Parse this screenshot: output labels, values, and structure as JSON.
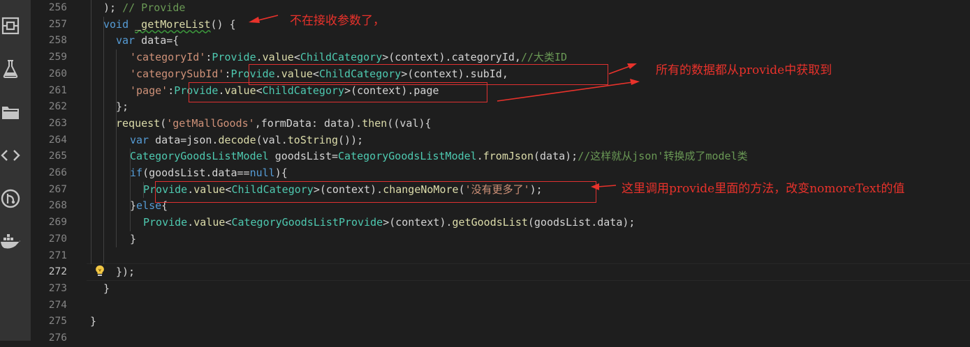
{
  "editor": {
    "current_line": "272",
    "line_numbers": [
      "256",
      "257",
      "258",
      "259",
      "260",
      "261",
      "262",
      "263",
      "264",
      "265",
      "266",
      "267",
      "268",
      "269",
      "270",
      "271",
      "272",
      "273",
      "274",
      "275",
      "276"
    ]
  },
  "activity_bar": [
    {
      "name": "explorer-icon"
    },
    {
      "name": "test-flask-icon"
    },
    {
      "name": "folder-icon"
    },
    {
      "name": "code-brackets-icon"
    },
    {
      "name": "git-icon"
    },
    {
      "name": "docker-icon"
    }
  ],
  "code_lines": [
    {
      "tokens": [
        [
          "pl",
          "); "
        ],
        [
          "cm",
          "// Provide"
        ]
      ]
    },
    {
      "tokens": [
        [
          "kw",
          "void"
        ],
        [
          "pl",
          " "
        ],
        [
          "fn",
          "_getMoreList"
        ],
        [
          "pl",
          "() {"
        ]
      ]
    },
    {
      "tokens": [
        [
          "kw",
          "var"
        ],
        [
          "pl",
          " data={"
        ]
      ]
    },
    {
      "tokens": [
        [
          "str",
          "'categoryId'"
        ],
        [
          "pl",
          ":"
        ],
        [
          "cls",
          "Provide"
        ],
        [
          "pl",
          "."
        ],
        [
          "fn",
          "value"
        ],
        [
          "pl",
          "<"
        ],
        [
          "cls",
          "ChildCategory"
        ],
        [
          "pl",
          ">(context).categoryId,"
        ],
        [
          "cm",
          "//大类ID"
        ]
      ]
    },
    {
      "tokens": [
        [
          "str",
          "'categorySubId'"
        ],
        [
          "pl",
          ":"
        ],
        [
          "cls",
          "Provide"
        ],
        [
          "pl",
          "."
        ],
        [
          "fn",
          "value"
        ],
        [
          "pl",
          "<"
        ],
        [
          "cls",
          "ChildCategory"
        ],
        [
          "pl",
          ">(context).subId,"
        ]
      ]
    },
    {
      "tokens": [
        [
          "str",
          "'page'"
        ],
        [
          "pl",
          ":"
        ],
        [
          "cls",
          "Provide"
        ],
        [
          "pl",
          "."
        ],
        [
          "fn",
          "value"
        ],
        [
          "pl",
          "<"
        ],
        [
          "cls",
          "ChildCategory"
        ],
        [
          "pl",
          ">(context).page"
        ]
      ]
    },
    {
      "tokens": [
        [
          "pl",
          "};"
        ]
      ]
    },
    {
      "tokens": [
        [
          "fn",
          "request"
        ],
        [
          "pl",
          "("
        ],
        [
          "str",
          "'getMallGoods'"
        ],
        [
          "pl",
          ",formData: data)."
        ],
        [
          "fn",
          "then"
        ],
        [
          "pl",
          "((val){"
        ]
      ]
    },
    {
      "tokens": [
        [
          "kw",
          "var"
        ],
        [
          "pl",
          " data=json."
        ],
        [
          "fn",
          "decode"
        ],
        [
          "pl",
          "(val."
        ],
        [
          "fn",
          "toString"
        ],
        [
          "pl",
          "());"
        ]
      ]
    },
    {
      "tokens": [
        [
          "cls",
          "CategoryGoodsListModel"
        ],
        [
          "pl",
          " goodsList="
        ],
        [
          "cls",
          "CategoryGoodsListModel"
        ],
        [
          "pl",
          "."
        ],
        [
          "fn",
          "fromJson"
        ],
        [
          "pl",
          "(data);"
        ],
        [
          "cm",
          "//这样就从json'转换成了model类"
        ]
      ]
    },
    {
      "tokens": [
        [
          "kw",
          "if"
        ],
        [
          "pl",
          "(goodsList.data=="
        ],
        [
          "kw",
          "null"
        ],
        [
          "pl",
          "){"
        ]
      ]
    },
    {
      "tokens": [
        [
          "cls",
          "Provide"
        ],
        [
          "pl",
          "."
        ],
        [
          "fn",
          "value"
        ],
        [
          "pl",
          "<"
        ],
        [
          "cls",
          "ChildCategory"
        ],
        [
          "pl",
          ">(context)."
        ],
        [
          "fn",
          "changeNoMore"
        ],
        [
          "pl",
          "("
        ],
        [
          "str",
          "'没有更多了'"
        ],
        [
          "pl",
          ");"
        ]
      ]
    },
    {
      "tokens": [
        [
          "pl",
          "}"
        ],
        [
          "kw",
          "else"
        ],
        [
          "pl",
          "{"
        ]
      ]
    },
    {
      "tokens": [
        [
          "cls",
          "Provide"
        ],
        [
          "pl",
          "."
        ],
        [
          "fn",
          "value"
        ],
        [
          "pl",
          "<"
        ],
        [
          "cls",
          "CategoryGoodsListProvide"
        ],
        [
          "pl",
          ">(context)."
        ],
        [
          "fn",
          "getGoodsList"
        ],
        [
          "pl",
          "(goodsList.data);"
        ]
      ]
    },
    {
      "tokens": [
        [
          "pl",
          "}"
        ]
      ]
    },
    {
      "tokens": []
    },
    {
      "tokens": [
        [
          "pl",
          "});"
        ]
      ]
    },
    {
      "tokens": [
        [
          "pl",
          "}"
        ]
      ]
    },
    {
      "tokens": []
    },
    {
      "tokens": [
        [
          "pl",
          "}"
        ]
      ]
    },
    {
      "tokens": []
    }
  ],
  "annotations": {
    "note1": "不在接收参数了，",
    "note2": "所有的数据都从provide中获取到",
    "note3": "这里调用provide里面的方法，改变nomoreText的值"
  },
  "colors": {
    "background": "#1e1e1e",
    "activity_bar": "#333333",
    "annotation_red": "#e8322b"
  }
}
